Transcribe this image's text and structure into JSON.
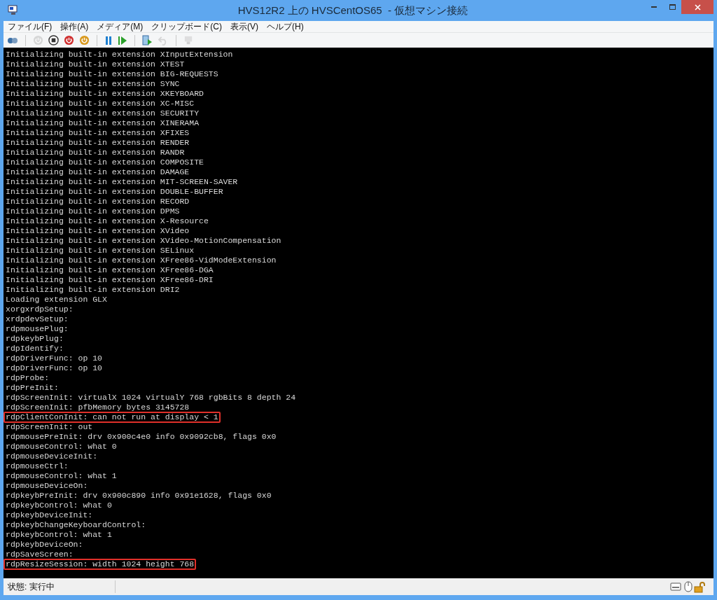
{
  "window": {
    "title": "HVS12R2 上の HVSCentOS65  - 仮想マシン接続"
  },
  "menu": [
    "ファイル(F)",
    "操作(A)",
    "メディア(M)",
    "クリップボード(C)",
    "表示(V)",
    "ヘルプ(H)"
  ],
  "toolbar": [
    {
      "kind": "ctrl-alt-del",
      "disabled": false
    },
    {
      "kind": "sep"
    },
    {
      "kind": "start",
      "disabled": true
    },
    {
      "kind": "stop",
      "disabled": false
    },
    {
      "kind": "shutdown",
      "disabled": false
    },
    {
      "kind": "save",
      "disabled": false
    },
    {
      "kind": "sep"
    },
    {
      "kind": "pause",
      "disabled": false
    },
    {
      "kind": "resume",
      "disabled": false
    },
    {
      "kind": "sep"
    },
    {
      "kind": "checkpoint",
      "disabled": false
    },
    {
      "kind": "revert",
      "disabled": true
    },
    {
      "kind": "sep"
    },
    {
      "kind": "enhanced",
      "disabled": true
    }
  ],
  "console": [
    {
      "text": "Initializing built-in extension XInputExtension",
      "highlighted": false
    },
    {
      "text": "Initializing built-in extension XTEST",
      "highlighted": false
    },
    {
      "text": "Initializing built-in extension BIG-REQUESTS",
      "highlighted": false
    },
    {
      "text": "Initializing built-in extension SYNC",
      "highlighted": false
    },
    {
      "text": "Initializing built-in extension XKEYBOARD",
      "highlighted": false
    },
    {
      "text": "Initializing built-in extension XC-MISC",
      "highlighted": false
    },
    {
      "text": "Initializing built-in extension SECURITY",
      "highlighted": false
    },
    {
      "text": "Initializing built-in extension XINERAMA",
      "highlighted": false
    },
    {
      "text": "Initializing built-in extension XFIXES",
      "highlighted": false
    },
    {
      "text": "Initializing built-in extension RENDER",
      "highlighted": false
    },
    {
      "text": "Initializing built-in extension RANDR",
      "highlighted": false
    },
    {
      "text": "Initializing built-in extension COMPOSITE",
      "highlighted": false
    },
    {
      "text": "Initializing built-in extension DAMAGE",
      "highlighted": false
    },
    {
      "text": "Initializing built-in extension MIT-SCREEN-SAVER",
      "highlighted": false
    },
    {
      "text": "Initializing built-in extension DOUBLE-BUFFER",
      "highlighted": false
    },
    {
      "text": "Initializing built-in extension RECORD",
      "highlighted": false
    },
    {
      "text": "Initializing built-in extension DPMS",
      "highlighted": false
    },
    {
      "text": "Initializing built-in extension X-Resource",
      "highlighted": false
    },
    {
      "text": "Initializing built-in extension XVideo",
      "highlighted": false
    },
    {
      "text": "Initializing built-in extension XVideo-MotionCompensation",
      "highlighted": false
    },
    {
      "text": "Initializing built-in extension SELinux",
      "highlighted": false
    },
    {
      "text": "Initializing built-in extension XFree86-VidModeExtension",
      "highlighted": false
    },
    {
      "text": "Initializing built-in extension XFree86-DGA",
      "highlighted": false
    },
    {
      "text": "Initializing built-in extension XFree86-DRI",
      "highlighted": false
    },
    {
      "text": "Initializing built-in extension DRI2",
      "highlighted": false
    },
    {
      "text": "Loading extension GLX",
      "highlighted": false
    },
    {
      "text": "xorgxrdpSetup:",
      "highlighted": false
    },
    {
      "text": "xrdpdevSetup:",
      "highlighted": false
    },
    {
      "text": "rdpmousePlug:",
      "highlighted": false
    },
    {
      "text": "rdpkeybPlug:",
      "highlighted": false
    },
    {
      "text": "rdpIdentify:",
      "highlighted": false
    },
    {
      "text": "rdpDriverFunc: op 10",
      "highlighted": false
    },
    {
      "text": "rdpDriverFunc: op 10",
      "highlighted": false
    },
    {
      "text": "rdpProbe:",
      "highlighted": false
    },
    {
      "text": "rdpPreInit:",
      "highlighted": false
    },
    {
      "text": "rdpScreenInit: virtualX 1024 virtualY 768 rgbBits 8 depth 24",
      "highlighted": false
    },
    {
      "text": "rdpScreenInit: pfbMemory bytes 3145728",
      "highlighted": false
    },
    {
      "text": "rdpClientConInit: can not run at display < 1",
      "highlighted": true
    },
    {
      "text": "rdpScreenInit: out",
      "highlighted": false
    },
    {
      "text": "rdpmousePreInit: drv 0x900c4e0 info 0x9092cb8, flags 0x0",
      "highlighted": false
    },
    {
      "text": "rdpmouseControl: what 0",
      "highlighted": false
    },
    {
      "text": "rdpmouseDeviceInit:",
      "highlighted": false
    },
    {
      "text": "rdpmouseCtrl:",
      "highlighted": false
    },
    {
      "text": "rdpmouseControl: what 1",
      "highlighted": false
    },
    {
      "text": "rdpmouseDeviceOn:",
      "highlighted": false
    },
    {
      "text": "rdpkeybPreInit: drv 0x900c890 info 0x91e1628, flags 0x0",
      "highlighted": false
    },
    {
      "text": "rdpkeybControl: what 0",
      "highlighted": false
    },
    {
      "text": "rdpkeybDeviceInit:",
      "highlighted": false
    },
    {
      "text": "rdpkeybChangeKeyboardControl:",
      "highlighted": false
    },
    {
      "text": "rdpkeybControl: what 1",
      "highlighted": false
    },
    {
      "text": "rdpkeybDeviceOn:",
      "highlighted": false
    },
    {
      "text": "rdpSaveScreen:",
      "highlighted": false
    },
    {
      "text": "rdpResizeSession: width 1024 height 768",
      "highlighted": true
    }
  ],
  "status_bar": {
    "status": "状態: 実行中"
  }
}
